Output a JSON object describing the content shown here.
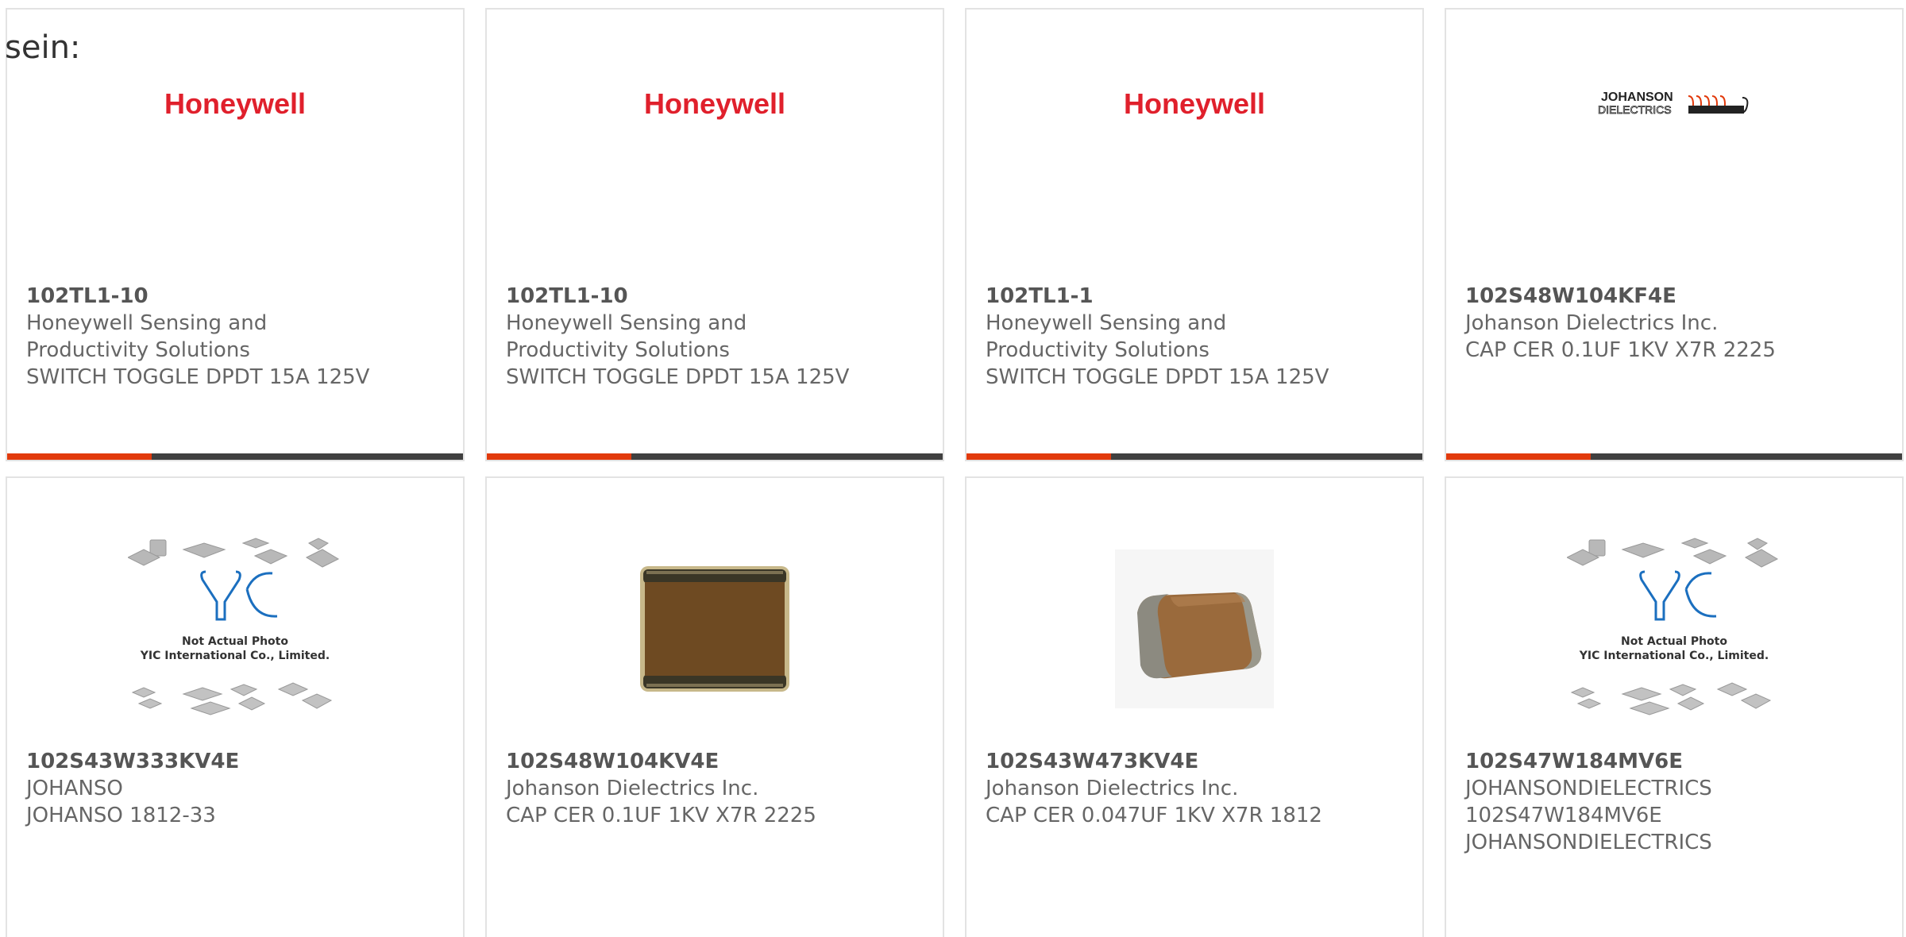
{
  "intro_text": "sein:",
  "accent_color": "#e23a0c",
  "cards": [
    {
      "part_number": "102TL1-10",
      "manufacturer_line1": "Honeywell Sensing and",
      "manufacturer_line2": "Productivity Solutions",
      "description": "SWITCH TOGGLE DPDT 15A 125V",
      "logo_text": "Honeywell"
    },
    {
      "part_number": "102TL1-10",
      "manufacturer_line1": "Honeywell Sensing and",
      "manufacturer_line2": "Productivity Solutions",
      "description": "SWITCH TOGGLE DPDT 15A 125V",
      "logo_text": "Honeywell"
    },
    {
      "part_number": "102TL1-1",
      "manufacturer_line1": "Honeywell Sensing and",
      "manufacturer_line2": "Productivity Solutions",
      "description": "SWITCH TOGGLE DPDT 15A 125V",
      "logo_text": "Honeywell"
    },
    {
      "part_number": "102S48W104KF4E",
      "manufacturer_line1": "Johanson Dielectrics Inc.",
      "description": "CAP CER 0.1UF 1KV X7R 2225",
      "logo_text_top": "JOHANSON",
      "logo_text_bottom": "DIELECTRICS"
    },
    {
      "part_number": "102S43W333KV4E",
      "manufacturer_line1": "JOHANSO",
      "description": "JOHANSO 1812-33",
      "placeholder_title": "Not Actual Photo",
      "placeholder_company": "YIC International Co., Limited.",
      "placeholder_logo": "YIC"
    },
    {
      "part_number": "102S48W104KV4E",
      "manufacturer_line1": "Johanson Dielectrics Inc.",
      "description": "CAP CER 0.1UF 1KV X7R 2225"
    },
    {
      "part_number": "102S43W473KV4E",
      "manufacturer_line1": "Johanson Dielectrics Inc.",
      "description": "CAP CER 0.047UF 1KV X7R 1812"
    },
    {
      "part_number": "102S47W184MV6E",
      "manufacturer_line1": "JOHANSONDIELECTRICS",
      "manufacturer_line2": "102S47W184MV6E",
      "description": "JOHANSONDIELECTRICS",
      "placeholder_title": "Not Actual Photo",
      "placeholder_company": "YIC International Co., Limited.",
      "placeholder_logo": "YIC"
    }
  ]
}
